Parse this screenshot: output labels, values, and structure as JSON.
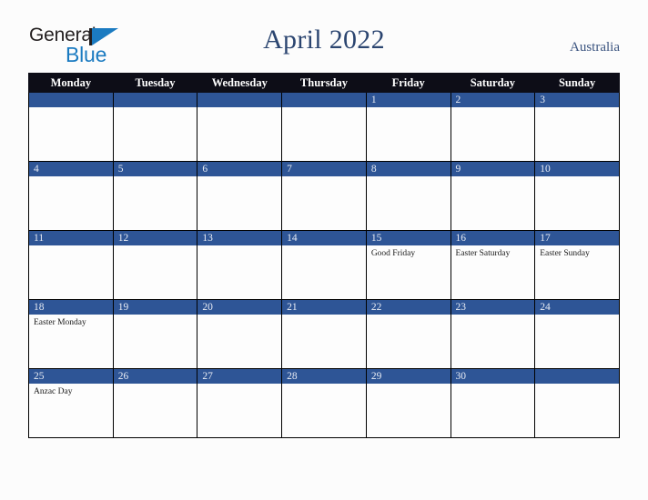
{
  "brand": {
    "logo_text_primary": "General",
    "logo_text_secondary": "Blue",
    "logo_triangle_icon": "triangle-icon",
    "primary_color": "#1b7bc1",
    "text_color": "#231f20"
  },
  "header": {
    "title": "April 2022",
    "country": "Australia",
    "title_color": "#2b4570",
    "country_color": "#3c5580"
  },
  "theme": {
    "header_row_bg": "#0d0d17",
    "header_row_text": "#ffffff",
    "daynum_band_bg": "#2e5596",
    "daynum_text": "#e8ecf4",
    "cell_bg": "#fdfdfd",
    "grid_line": "#000000",
    "page_bg": "#fcfcfc"
  },
  "calendar": {
    "month": "April",
    "year": "2022",
    "weekday_headers": [
      "Monday",
      "Tuesday",
      "Wednesday",
      "Thursday",
      "Friday",
      "Saturday",
      "Sunday"
    ],
    "weeks": [
      [
        {
          "day": "",
          "holiday": ""
        },
        {
          "day": "",
          "holiday": ""
        },
        {
          "day": "",
          "holiday": ""
        },
        {
          "day": "",
          "holiday": ""
        },
        {
          "day": "1",
          "holiday": ""
        },
        {
          "day": "2",
          "holiday": ""
        },
        {
          "day": "3",
          "holiday": ""
        }
      ],
      [
        {
          "day": "4",
          "holiday": ""
        },
        {
          "day": "5",
          "holiday": ""
        },
        {
          "day": "6",
          "holiday": ""
        },
        {
          "day": "7",
          "holiday": ""
        },
        {
          "day": "8",
          "holiday": ""
        },
        {
          "day": "9",
          "holiday": ""
        },
        {
          "day": "10",
          "holiday": ""
        }
      ],
      [
        {
          "day": "11",
          "holiday": ""
        },
        {
          "day": "12",
          "holiday": ""
        },
        {
          "day": "13",
          "holiday": ""
        },
        {
          "day": "14",
          "holiday": ""
        },
        {
          "day": "15",
          "holiday": "Good Friday"
        },
        {
          "day": "16",
          "holiday": "Easter Saturday"
        },
        {
          "day": "17",
          "holiday": "Easter Sunday"
        }
      ],
      [
        {
          "day": "18",
          "holiday": "Easter Monday"
        },
        {
          "day": "19",
          "holiday": ""
        },
        {
          "day": "20",
          "holiday": ""
        },
        {
          "day": "21",
          "holiday": ""
        },
        {
          "day": "22",
          "holiday": ""
        },
        {
          "day": "23",
          "holiday": ""
        },
        {
          "day": "24",
          "holiday": ""
        }
      ],
      [
        {
          "day": "25",
          "holiday": "Anzac Day"
        },
        {
          "day": "26",
          "holiday": ""
        },
        {
          "day": "27",
          "holiday": ""
        },
        {
          "day": "28",
          "holiday": ""
        },
        {
          "day": "29",
          "holiday": ""
        },
        {
          "day": "30",
          "holiday": ""
        },
        {
          "day": "",
          "holiday": ""
        }
      ]
    ]
  }
}
